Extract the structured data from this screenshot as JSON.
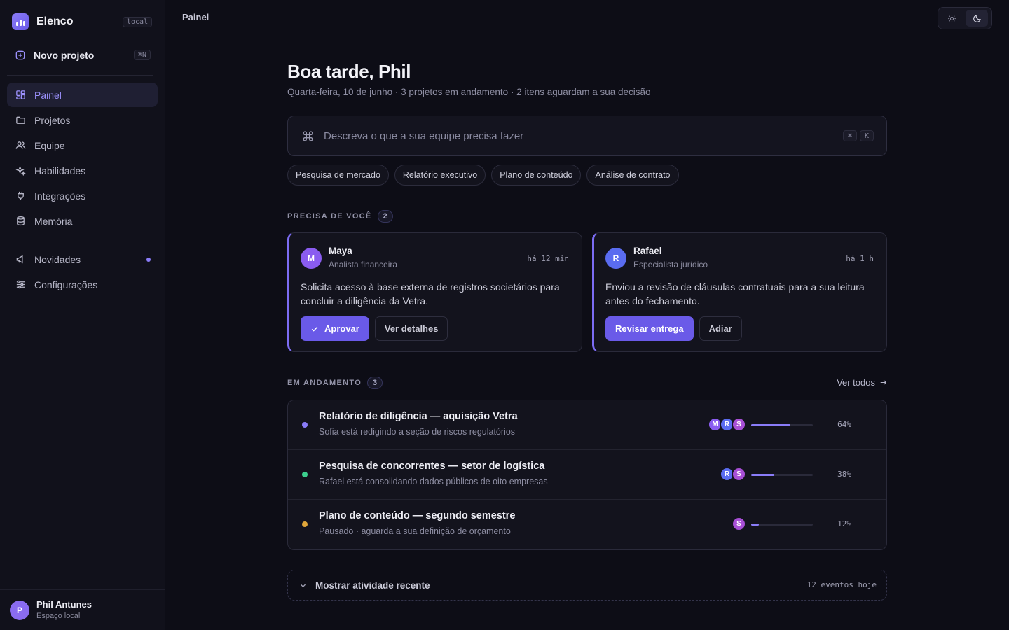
{
  "app": {
    "name": "Elenco",
    "env_badge": "local"
  },
  "sidebar": {
    "new_project": {
      "label": "Novo projeto",
      "shortcut": "⌘N"
    },
    "items": [
      {
        "label": "Painel",
        "icon": "layout-dashboard-icon",
        "active": true
      },
      {
        "label": "Projetos",
        "icon": "folder-icon"
      },
      {
        "label": "Equipe",
        "icon": "users-icon"
      },
      {
        "label": "Habilidades",
        "icon": "sparkles-icon"
      },
      {
        "label": "Integrações",
        "icon": "plug-icon"
      },
      {
        "label": "Memória",
        "icon": "database-icon"
      }
    ],
    "secondary": [
      {
        "label": "Novidades",
        "icon": "megaphone-icon",
        "unread_dot": true
      },
      {
        "label": "Configurações",
        "icon": "sliders-icon"
      }
    ],
    "user": {
      "initial": "P",
      "name": "Phil Antunes",
      "workspace": "Espaço local"
    }
  },
  "topbar": {
    "breadcrumb": "Painel",
    "theme": "dark"
  },
  "main": {
    "greeting": "Boa tarde, Phil",
    "subtitle": "Quarta-feira, 10 de junho · 3 projetos em andamento · 2 itens aguardam a sua decisão",
    "prompt": {
      "placeholder": "Descreva o que a sua equipe precisa fazer",
      "keys": [
        "⌘",
        "K"
      ]
    },
    "suggestions": [
      "Pesquisa de mercado",
      "Relatório executivo",
      "Plano de conteúdo",
      "Análise de contrato"
    ],
    "needs_you": {
      "title": "PRECISA DE VOCÊ",
      "count": "2",
      "cards": [
        {
          "initial": "M",
          "avatar_color": "#8a5cf0",
          "name": "Maya",
          "role": "Analista financeira",
          "when": "há 12 min",
          "message": "Solicita acesso à base externa de registros societários para concluir a diligência da Vetra.",
          "primary": "Aprovar",
          "secondary": "Ver detalhes"
        },
        {
          "initial": "R",
          "avatar_color": "#5a6cf0",
          "name": "Rafael",
          "role": "Especialista jurídico",
          "when": "há 1 h",
          "message": "Enviou a revisão de cláusulas contratuais para a sua leitura antes do fechamento.",
          "primary": "Revisar entrega",
          "secondary": "Adiar"
        }
      ]
    },
    "in_progress": {
      "title": "EM ANDAMENTO",
      "count": "3",
      "see_all": "Ver todos",
      "projects": [
        {
          "title": "Relatório de diligência — aquisição Vetra",
          "subtitle": "Sofia está redigindo a seção de riscos regulatórios",
          "status_color": "#8a7cf8",
          "avatars": [
            "M",
            "R",
            "S"
          ],
          "progress": 0.64,
          "progress_label": "64%"
        },
        {
          "title": "Pesquisa de concorrentes — setor de logística",
          "subtitle": "Rafael está consolidando dados públicos de oito empresas",
          "status_color": "#3ccf8e",
          "avatars": [
            "R",
            "S"
          ],
          "progress": 0.38,
          "progress_label": "38%"
        },
        {
          "title": "Plano de conteúdo — segundo semestre",
          "subtitle": "Pausado · aguarda a sua definição de orçamento",
          "status_color": "#e0a63a",
          "avatars": [
            "S"
          ],
          "progress": 0.12,
          "progress_label": "12%"
        }
      ]
    },
    "recent": {
      "label": "Mostrar atividade recente",
      "count": "12 eventos hoje"
    }
  },
  "colors": {
    "accent": "#6a5ae8",
    "avatar_M": "#8a5cf0",
    "avatar_R": "#5a6cf0",
    "avatar_S": "#a84fd6"
  }
}
